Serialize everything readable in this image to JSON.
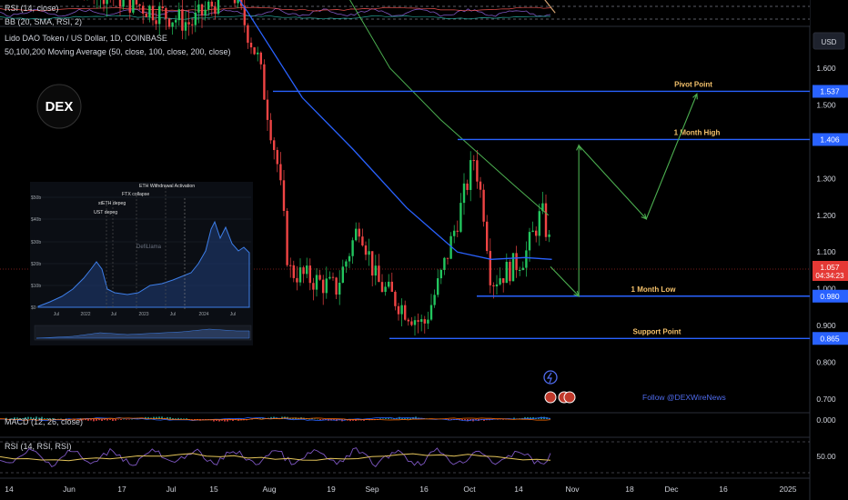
{
  "header": {
    "rsi_top": "RSI (14, close)",
    "indicator_top2": "BB (20, SMA, RSI, 2)",
    "symbol": "Lido DAO Token / US Dollar, 1D, COINBASE",
    "ma_legend": "50,100,200 Moving Average (50, close, 100, close, 200, close)"
  },
  "price_axis": {
    "currency": "USD",
    "ticks": [
      "1.600",
      "1.500",
      "1.400",
      "1.300",
      "1.200",
      "1.100",
      "1.000",
      "0.900",
      "0.800",
      "0.700"
    ],
    "tick_values": [
      1.6,
      1.5,
      1.4,
      1.3,
      1.2,
      1.1,
      1.0,
      0.9,
      0.8,
      0.7
    ],
    "current_price": "1.057",
    "countdown": "04:34:23"
  },
  "levels": [
    {
      "label": "Pivot Point",
      "value": 1.537,
      "tag": "1.537"
    },
    {
      "label": "1 Month High",
      "value": 1.406,
      "tag": "1.406"
    },
    {
      "label": "1 Month Low",
      "value": 0.98,
      "tag": "0.980"
    },
    {
      "label": "Support Point",
      "value": 0.865,
      "tag": "0.865"
    }
  ],
  "x_axis": {
    "labels": [
      "14",
      "Jun",
      "17",
      "Jul",
      "15",
      "Aug",
      "19",
      "Sep",
      "16",
      "Oct",
      "14",
      "Nov",
      "18",
      "Dec",
      "16",
      "2025"
    ]
  },
  "watermark": {
    "logo": "DEX",
    "follow": "Follow @DEXWireNews"
  },
  "inset": {
    "y_ticks": [
      "$50b",
      "$40b",
      "$30b",
      "$20b",
      "$10b",
      "$0"
    ],
    "x_ticks": [
      "Jul",
      "2022",
      "Jul",
      "2023",
      "Jul",
      "2024",
      "Jul"
    ],
    "annotations": [
      "ETH Withdrawal Activation",
      "FTX collapse",
      "stETH depeg",
      "UST depeg"
    ],
    "brand": "DefiLlama"
  },
  "macd": {
    "label": "MACD (12, 26, close)",
    "tick": "0.000"
  },
  "rsi_bottom": {
    "label": "RSI (14, RSI, RSI)",
    "tick": "50.00"
  },
  "colors": {
    "up": "#26a69a",
    "bull": "#22c55e",
    "bear": "#ef4444",
    "level": "#2962ff",
    "ma50": "#2962ff",
    "ma100": "#4caf50",
    "ma200": "#d4a373",
    "projection": "#4caf50",
    "label_text": "#f5c26b",
    "price_tag": "#e53935"
  },
  "chart_data": {
    "type": "candlestick",
    "title": "Lido DAO Token / US Dollar, 1D, COINBASE",
    "ylabel": "USD",
    "ylim": [
      0.68,
      1.69
    ],
    "x_range": [
      "2024-05-14",
      "2025-01-01"
    ],
    "series": [
      {
        "name": "Pivot Point",
        "values": [
          1.537
        ]
      },
      {
        "name": "1 Month High",
        "values": [
          1.406
        ]
      },
      {
        "name": "1 Month Low",
        "values": [
          0.98
        ]
      },
      {
        "name": "Support Point",
        "values": [
          0.865
        ]
      }
    ],
    "key_prices": {
      "last": 1.057,
      "august_high_area": 1.7,
      "september_low": 0.87,
      "october_high": 1.39,
      "october_end": 1.06
    },
    "projection_path": [
      {
        "date": "2024-10-22",
        "price": 1.06
      },
      {
        "date": "2024-10-31",
        "price": 0.98
      },
      {
        "date": "2024-10-31",
        "price": 1.39
      },
      {
        "date": "2024-11-20",
        "price": 1.19
      },
      {
        "date": "2024-12-05",
        "price": 1.53
      }
    ]
  }
}
